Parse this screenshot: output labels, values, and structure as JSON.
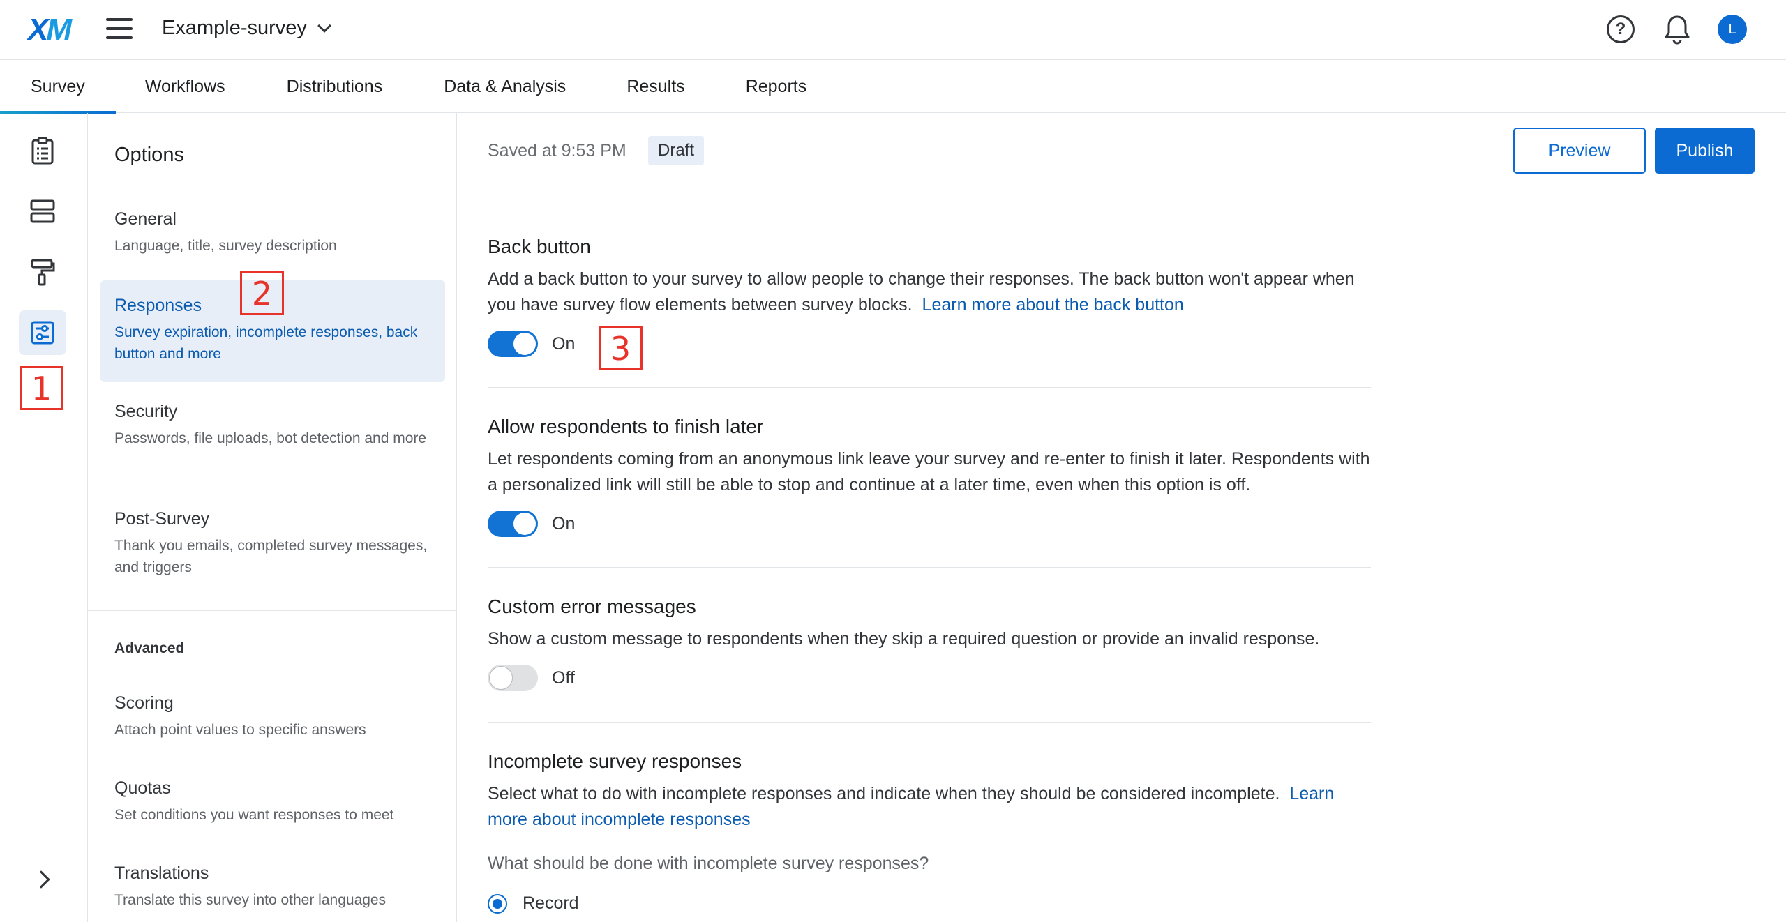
{
  "header": {
    "logo_x": "X",
    "logo_m": "M",
    "survey_name": "Example-survey",
    "avatar_initial": "L"
  },
  "tabs": [
    {
      "label": "Survey",
      "active": true
    },
    {
      "label": "Workflows"
    },
    {
      "label": "Distributions"
    },
    {
      "label": "Data & Analysis"
    },
    {
      "label": "Results"
    },
    {
      "label": "Reports"
    }
  ],
  "rail": {
    "items": [
      {
        "icon": "clipboard-icon"
      },
      {
        "icon": "survey-flow-icon"
      },
      {
        "icon": "paint-roller-icon"
      },
      {
        "icon": "survey-options-icon",
        "active": true
      }
    ],
    "expand_icon": "chevron-right-icon"
  },
  "options": {
    "title": "Options",
    "items": [
      {
        "label": "General",
        "desc": "Language, title, survey description"
      },
      {
        "label": "Responses",
        "desc": "Survey expiration, incomplete responses, back button and more",
        "active": true
      },
      {
        "label": "Security",
        "desc": "Passwords, file uploads, bot detection and more"
      },
      {
        "label": "Post-Survey",
        "desc": "Thank you emails, completed survey messages, and triggers"
      }
    ],
    "advanced_heading": "Advanced",
    "advanced_items": [
      {
        "label": "Scoring",
        "desc": "Attach point values to specific answers"
      },
      {
        "label": "Quotas",
        "desc": "Set conditions you want responses to meet"
      },
      {
        "label": "Translations",
        "desc": "Translate this survey into other languages"
      }
    ]
  },
  "content": {
    "saved_text": "Saved at 9:53 PM",
    "status_badge": "Draft",
    "preview_label": "Preview",
    "publish_label": "Publish",
    "settings": {
      "back_button": {
        "title": "Back button",
        "desc": "Add a back button to your survey to allow people to change their responses. The back button won't appear when you have survey flow elements between survey blocks.",
        "link": "Learn more about the back button",
        "toggle_label": "On",
        "enabled": true
      },
      "finish_later": {
        "title": "Allow respondents to finish later",
        "desc": "Let respondents coming from an anonymous link leave your survey and re-enter to finish it later. Respondents with a personalized link will still be able to stop and continue at a later time, even when this option is off.",
        "toggle_label": "On",
        "enabled": true
      },
      "custom_errors": {
        "title": "Custom error messages",
        "desc": "Show a custom message to respondents when they skip a required question or provide an invalid response.",
        "toggle_label": "Off",
        "enabled": false
      },
      "incomplete": {
        "title": "Incomplete survey responses",
        "desc": "Select what to do with incomplete responses and indicate when they should be considered incomplete.",
        "link": "Learn more about incomplete responses",
        "question": "What should be done with incomplete survey responses?",
        "option_record": "Record"
      }
    }
  },
  "annotations": [
    "1",
    "2",
    "3"
  ],
  "colors": {
    "accent": "#0b6bd3",
    "annotation": "#e8332a",
    "active_bg": "#e7eef7"
  }
}
